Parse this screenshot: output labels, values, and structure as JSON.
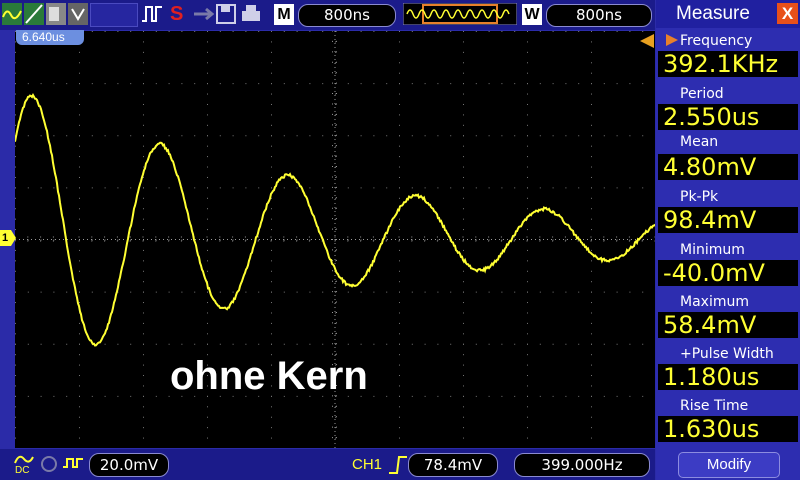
{
  "topbar": {
    "timebase": "800ns",
    "position": "800ns",
    "m_label": "M",
    "w_label": "W",
    "run_state": "S"
  },
  "screen": {
    "trigger_time": "6.640us",
    "channel_marker": "1",
    "overlay_text": "ohne Kern",
    "trace_color": "#ffff33"
  },
  "measure": {
    "title": "Measure",
    "close_label": "X",
    "items": [
      {
        "label": "Frequency",
        "value": "392.1KHz"
      },
      {
        "label": "Period",
        "value": "2.550us"
      },
      {
        "label": "Mean",
        "value": "4.80mV"
      },
      {
        "label": "Pk-Pk",
        "value": "98.4mV"
      },
      {
        "label": "Minimum",
        "value": "-40.0mV"
      },
      {
        "label": "Maximum",
        "value": "58.4mV"
      },
      {
        "label": "+Pulse Width",
        "value": "1.180us"
      },
      {
        "label": "Rise Time",
        "value": "1.630us"
      }
    ],
    "modify_label": "Modify"
  },
  "bottom": {
    "coupling": "DC",
    "volts_div": "20.0mV",
    "trigger_channel": "CH1",
    "trigger_level": "78.4mV",
    "trigger_freq": "399.000Hz"
  }
}
